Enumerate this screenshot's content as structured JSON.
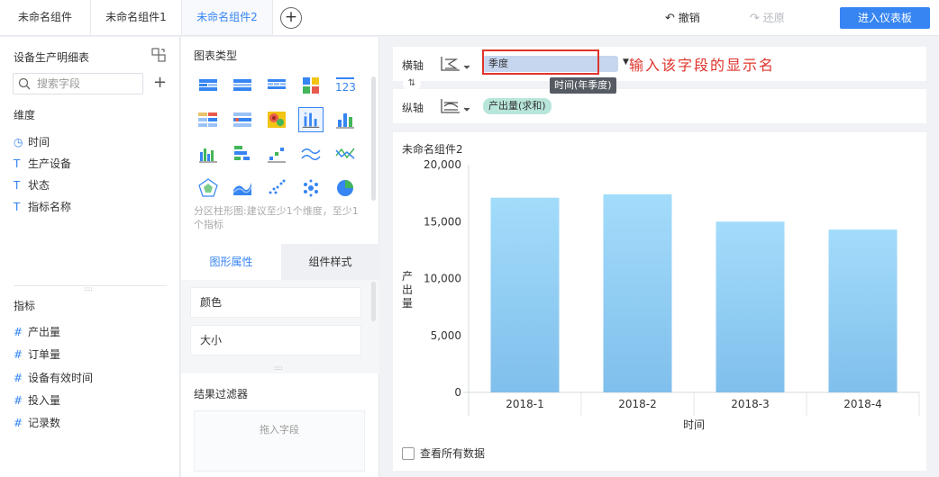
{
  "tabs": [
    {
      "label": "未命名组件"
    },
    {
      "label": "未命名组件1"
    },
    {
      "label": "未命名组件2",
      "active": true
    }
  ],
  "toolbar": {
    "undo_label": "撤销",
    "redo_label": "还原",
    "enter_label": "进入仪表板"
  },
  "left": {
    "dataset_title": "设备生产明细表",
    "search_placeholder": "搜索字段",
    "dimension_title": "维度",
    "dimensions": [
      {
        "label": "时间",
        "icon": "clock-icon"
      },
      {
        "label": "生产设备",
        "icon": "text-icon"
      },
      {
        "label": "状态",
        "icon": "text-icon"
      },
      {
        "label": "指标名称",
        "icon": "text-icon"
      }
    ],
    "measure_title": "指标",
    "measures": [
      {
        "label": "产出量",
        "icon": "hash-icon"
      },
      {
        "label": "订单量",
        "icon": "hash-icon"
      },
      {
        "label": "设备有效时间",
        "icon": "hash-icon"
      },
      {
        "label": "投入量",
        "icon": "hash-icon"
      },
      {
        "label": "记录数",
        "icon": "hash-icon"
      }
    ]
  },
  "middle": {
    "chart_type_title": "图表类型",
    "chart_hint": "分区柱形图:建议至少1个维度，至少1个指标",
    "prop_tabs": [
      "图形属性",
      "组件样式"
    ],
    "props": [
      "颜色",
      "大小"
    ],
    "filter_title": "结果过滤器",
    "drop_hint": "拖入字段"
  },
  "axes": {
    "x_label": "横轴",
    "x_field": "季度",
    "x_tooltip": "时间(年季度)",
    "y_label": "纵轴",
    "y_field": "产出量(求和)"
  },
  "annotation": "输入该字段的显示名",
  "chart_panel": {
    "title": "未命名组件2",
    "show_all_label": "查看所有数据"
  },
  "chart_data": {
    "type": "bar",
    "categories": [
      "2018-1",
      "2018-2",
      "2018-3",
      "2018-4"
    ],
    "values": [
      17100,
      17400,
      15000,
      14300
    ],
    "xlabel": "时间",
    "ylabel": "产出量",
    "ylim": [
      0,
      20000
    ],
    "yticks": [
      "20,000",
      "15,000",
      "10,000",
      "5,000",
      "0"
    ],
    "bar_color_top": "#a3dcfb",
    "bar_color_bottom": "#80bfec",
    "grid": false
  },
  "colors": {
    "accent": "#3685f2",
    "annotation": "#e0342c",
    "y_pill": "#b8e6db",
    "x_pill": "#c7d6ef"
  }
}
